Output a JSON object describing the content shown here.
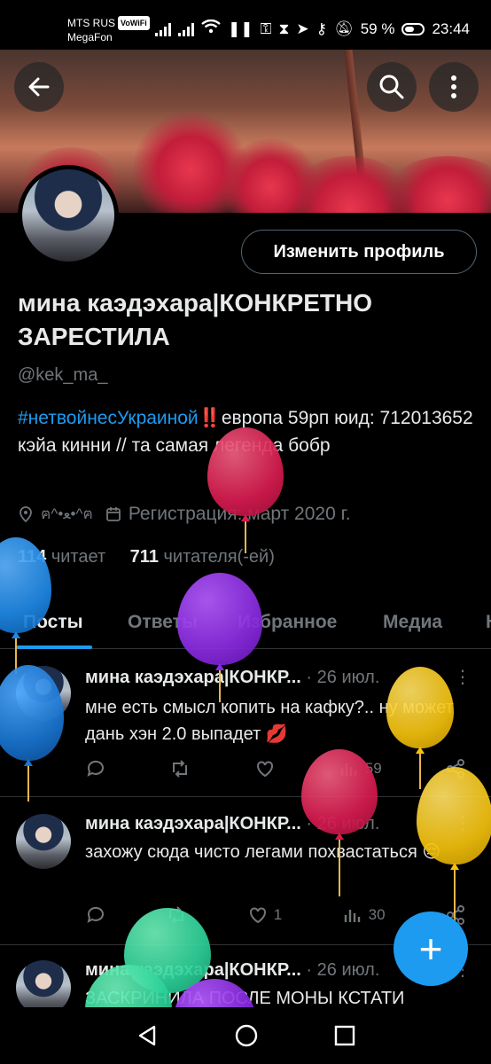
{
  "status_bar": {
    "carrier1": "MTS RUS",
    "vowifi": "VoWiFi",
    "carrier2": "MegaFon",
    "battery": "59 %",
    "time": "23:44"
  },
  "profile": {
    "edit_button": "Изменить профиль",
    "name": "мина каэдэхара|КОНКРЕТНО ЗАРЕСТИЛА",
    "handle": "@kek_ma_",
    "bio_hashtag": "#нетвойнесУкраиной",
    "bio_rest": "‼️европа 59рп юид: 712013652 кэйа кинни // та самая легенда бобр",
    "location": "ฅ^•ﻌ•^ฅ",
    "joined": "Регистрация: март 2020 г.",
    "following_count": "114",
    "following_label": "читает",
    "followers_count": "711",
    "followers_label": "читателя(-ей)"
  },
  "tabs": [
    {
      "label": "Посты"
    },
    {
      "label": "Ответы"
    },
    {
      "label": "Избранное"
    },
    {
      "label": "Медиа"
    },
    {
      "label": "Н"
    }
  ],
  "posts": [
    {
      "author": "мина каэдэхара|КОНКР...",
      "date": "· 26 июл.",
      "text": "мне есть смысл копить на кафку?.. ну может дань хэн 2.0 выпадет 💋",
      "views": "59"
    },
    {
      "author": "мина каэдэхара|КОНКР...",
      "date": "· 26 июл.",
      "text": "захожу сюда чисто легами похвастаться 😔",
      "likes": "1",
      "views": "30"
    },
    {
      "author": "мина каэдэхара|КОНКР...",
      "date": "· 26 июл.",
      "text": "ЗАСКРИНИЛА ПОСЛЕ МОНЫ КСТАТИ"
    }
  ],
  "colors": {
    "accent": "#1d9bf0",
    "background": "#000000",
    "muted": "#71767b"
  }
}
